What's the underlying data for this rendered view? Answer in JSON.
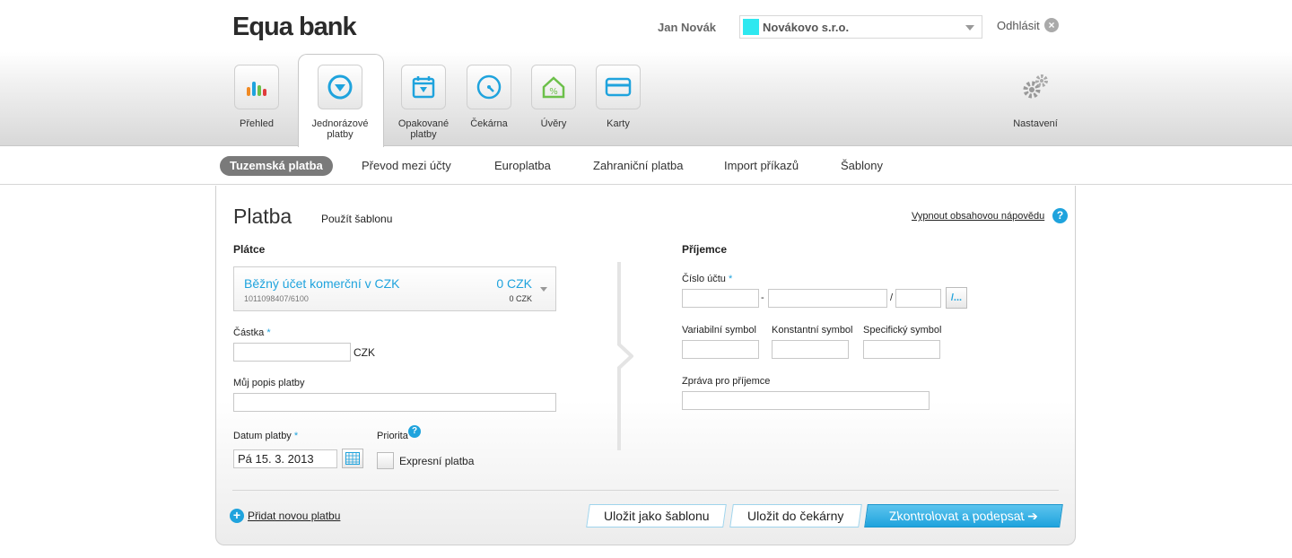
{
  "header": {
    "logo": "Equa bank",
    "user_name": "Jan Novák",
    "company": "Novákovo s.r.o.",
    "company_swatch_color": "#2ee8f0",
    "logout": "Odhlásit"
  },
  "nav": {
    "items": [
      {
        "label": "Přehled",
        "icon": "chart-icon"
      },
      {
        "label": "Jednorázové platby",
        "icon": "payment-icon",
        "active": true
      },
      {
        "label": "Opakované platby",
        "icon": "calendar-icon"
      },
      {
        "label": "Čekárna",
        "icon": "timer-icon"
      },
      {
        "label": "Úvěry",
        "icon": "house-percent-icon"
      },
      {
        "label": "Karty",
        "icon": "card-icon"
      }
    ],
    "settings": "Nastavení"
  },
  "subnav": {
    "tabs": [
      "Tuzemská platba",
      "Převod mezi účty",
      "Europlatba",
      "Zahraniční platba",
      "Import příkazů",
      "Šablony"
    ],
    "active": "Tuzemská platba"
  },
  "form": {
    "title": "Platba",
    "use_template": "Použít šablonu",
    "help_toggle": "Vypnout obsahovou nápovědu",
    "payer": {
      "heading": "Plátce",
      "account_name": "Běžný účet komerční v CZK",
      "account_number": "1011098407/6100",
      "balance": "0 CZK",
      "available": "0 CZK"
    },
    "amount": {
      "label": "Částka",
      "value": "",
      "currency": "CZK"
    },
    "my_description": {
      "label": "Můj popis platby",
      "value": ""
    },
    "date": {
      "label": "Datum platby",
      "value": "Pá 15. 3. 2013"
    },
    "priority": {
      "label": "Priorita",
      "express_label": "Expresní platba",
      "express_checked": false
    },
    "recipient": {
      "heading": "Příjemce",
      "account_label": "Číslo účtu",
      "prefix": "",
      "number": "",
      "bank_code": "",
      "bank_button": "/...",
      "variable_symbol_label": "Variabilní symbol",
      "constant_symbol_label": "Konstantní symbol",
      "specific_symbol_label": "Specifický symbol",
      "message_label": "Zpráva pro příjemce"
    },
    "add_payment": "Přidat novou platbu",
    "buttons": {
      "save_template": "Uložit jako šablonu",
      "save_waiting": "Uložit do čekárny",
      "check_sign": "Zkontrolovat a podepsat"
    }
  },
  "colors": {
    "accent": "#1fa3dd",
    "active_tab": "#7a7a7a"
  }
}
